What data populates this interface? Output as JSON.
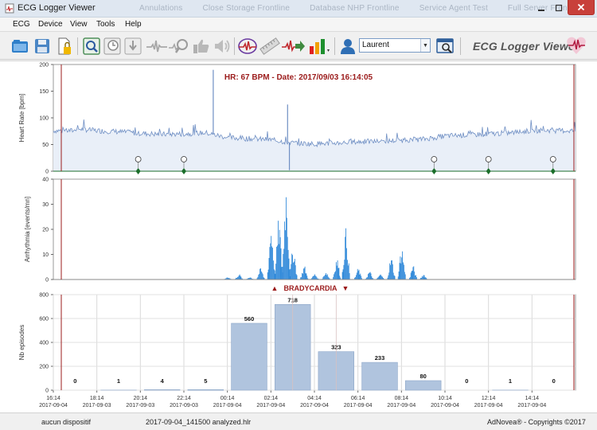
{
  "window": {
    "title": "ECG Logger Viewer",
    "ghost_tabs": [
      "Annulations",
      "Close Storage Frontline",
      "Database NHP Frontline",
      "Service Agent Test",
      "Full Server Frontline"
    ]
  },
  "menu": [
    "ECG",
    "Device",
    "View",
    "Tools",
    "Help"
  ],
  "toolbar": {
    "user": "Laurent",
    "brand": "ECG Logger Viewer",
    "icons": [
      "open-folder",
      "save",
      "locked-file",
      "zoom-document",
      "record-history",
      "download",
      "ecg-wave",
      "heart-zoom",
      "thumbs-up",
      "speaker",
      "ecg-analyze",
      "ruler",
      "ecg-export",
      "bar-chart",
      "user",
      "search-database",
      "brand-heart"
    ]
  },
  "heart_rate_chart": {
    "title": "HR: 67 BPM - Date: 2017/09/03 16:14:05",
    "ylabel": "Heart Rate [bpm]",
    "y_ticks": [
      "200",
      "150",
      "100",
      "50",
      "0"
    ]
  },
  "arrhythmia_chart": {
    "ylabel": "Arrhythmia [events/mn]",
    "y_ticks": [
      "40",
      "30",
      "20",
      "10",
      "0"
    ],
    "nav_label": "BRADYCARDIA",
    "nav_prev": "▲",
    "nav_next": "▼"
  },
  "episodes_chart": {
    "ylabel": "Nb episodes",
    "y_ticks": [
      "800",
      "600",
      "400",
      "200",
      "0"
    ]
  },
  "x_axis": [
    {
      "time": "18:14",
      "date": "2017-09-03"
    },
    {
      "time": "20:14",
      "date": "2017-09-03"
    },
    {
      "time": "22:14",
      "date": "2017-09-03"
    },
    {
      "time": "00:14",
      "date": "2017-09-04"
    },
    {
      "time": "02:14",
      "date": "2017-09-04"
    },
    {
      "time": "04:14",
      "date": "2017-09-04"
    },
    {
      "time": "06:14",
      "date": "2017-09-04"
    },
    {
      "time": "08:14",
      "date": "2017-09-04"
    },
    {
      "time": "10:14",
      "date": "2017-09-04"
    },
    {
      "time": "12:14",
      "date": "2017-09-04"
    },
    {
      "time": "14:14",
      "date": "2017-09-04"
    },
    {
      "time": "16:14",
      "date": "2017-09-04"
    }
  ],
  "chart_data": [
    {
      "type": "line",
      "name": "heart_rate",
      "ylim": [
        0,
        200
      ],
      "x": [
        "17:14",
        "18:14",
        "19:14",
        "20:14",
        "21:14",
        "22:14",
        "23:14",
        "00:14",
        "01:14",
        "02:14",
        "03:14",
        "04:14",
        "05:14",
        "06:14",
        "07:14",
        "08:14",
        "09:14",
        "10:14",
        "11:14",
        "12:14",
        "13:14",
        "14:14",
        "15:14",
        "16:14"
      ],
      "values": [
        80,
        76,
        74,
        71,
        69,
        70,
        72,
        63,
        61,
        59,
        53,
        51,
        53,
        55,
        56,
        58,
        60,
        66,
        68,
        70,
        72,
        76,
        77,
        76
      ],
      "spikes": [
        {
          "x": "23:35",
          "value": 190
        },
        {
          "x": "03:00",
          "value": 125
        },
        {
          "x": "03:05",
          "value": 2
        }
      ],
      "event_markers": [
        "20:08",
        "22:14",
        "09:44",
        "12:14",
        "15:12"
      ],
      "grid": false
    },
    {
      "type": "bar",
      "name": "arrhythmia",
      "ylim": [
        0,
        40
      ],
      "x": [
        "00:14",
        "00:45",
        "01:15",
        "01:45",
        "02:14",
        "02:35",
        "02:55",
        "03:15",
        "03:45",
        "04:14",
        "04:45",
        "05:15",
        "05:40",
        "06:14",
        "06:45",
        "07:15",
        "07:45",
        "08:14",
        "08:45",
        "09:14"
      ],
      "values": [
        1,
        2,
        1,
        4,
        20,
        22,
        35,
        12,
        5,
        2,
        3,
        8,
        18,
        4,
        3,
        2,
        8,
        12,
        5,
        2
      ],
      "grid": false
    },
    {
      "type": "bar",
      "name": "bradycardia_episodes",
      "title": "BRADYCARDIA",
      "ylabel": "Nb episodes",
      "ylim": [
        0,
        800
      ],
      "categories": [
        "16:14",
        "18:14",
        "20:14",
        "22:14",
        "00:14",
        "02:14",
        "04:14",
        "06:14",
        "08:14",
        "10:14",
        "12:14",
        "14:14"
      ],
      "values": [
        0,
        1,
        4,
        5,
        560,
        718,
        323,
        233,
        80,
        0,
        1,
        0
      ],
      "grid": true
    }
  ],
  "status": {
    "device": "aucun dispositif",
    "file": "2017-09-04_141500 analyzed.hlr",
    "copyright": "AdNovea® - Copyrights ©2017"
  },
  "colors": {
    "hr_line": "#6f8fc4",
    "hr_fill": "#e9eff8",
    "arrhythmia": "#1f7fd6",
    "episode_bar": "#b0c4de",
    "episode_bar_edge": "#8ea7c8",
    "cursor": "#9b1b1b",
    "marker": "#1b6e2a",
    "title_red": "#9b1b1b"
  }
}
